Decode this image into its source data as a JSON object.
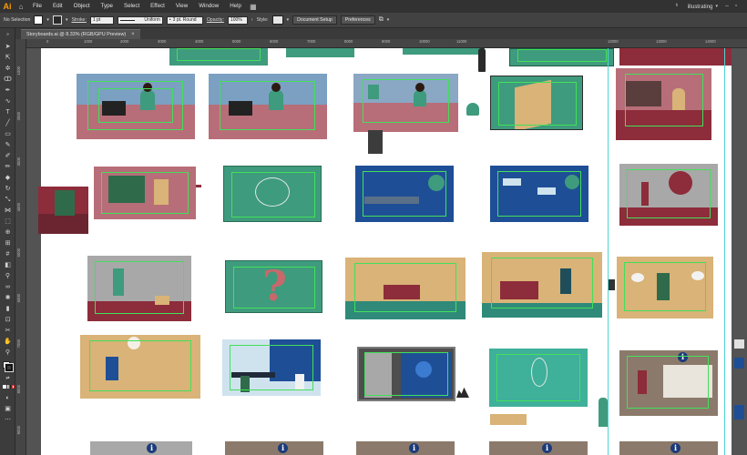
{
  "app": {
    "logo": "Ai"
  },
  "menus": [
    "File",
    "Edit",
    "Object",
    "Type",
    "Select",
    "Effect",
    "View",
    "Window",
    "Help"
  ],
  "workspace": {
    "name": "illustrating",
    "caret": "▾"
  },
  "control_bar": {
    "selection_label": "No Selection",
    "stroke_label": "Stroke:",
    "stroke_weight": "1 pt",
    "profile": "Uniform",
    "brush": "3 pt. Round",
    "opacity_label": "Opacity:",
    "opacity_value": "100%",
    "style_label": "Style:",
    "document_setup": "Document Setup",
    "preferences": "Preferences"
  },
  "tab": {
    "title": "Storyboards.ai @ 8.33% (RGB/GPU Preview)",
    "close": "×"
  },
  "ruler": {
    "h_ticks": [
      "0",
      "1000",
      "2000",
      "3000",
      "4000",
      "5000",
      "6000",
      "7000",
      "8000",
      "9000",
      "10000",
      "11000",
      "12000",
      "13000",
      "14000"
    ],
    "v_ticks": [
      "1000",
      "2000",
      "3000",
      "4000",
      "5000",
      "6000",
      "7000",
      "8000",
      "9000"
    ]
  },
  "canvas": {
    "info_glyph": "i",
    "question_glyph": "?",
    "colors": {
      "teal": "#3f9b7d",
      "navy": "#1e4f96",
      "maroon": "#8d2c3a",
      "mauve": "#b76e78",
      "tan": "#d9b377",
      "gray": "#a8a8a8",
      "guide": "#42e05a"
    }
  }
}
